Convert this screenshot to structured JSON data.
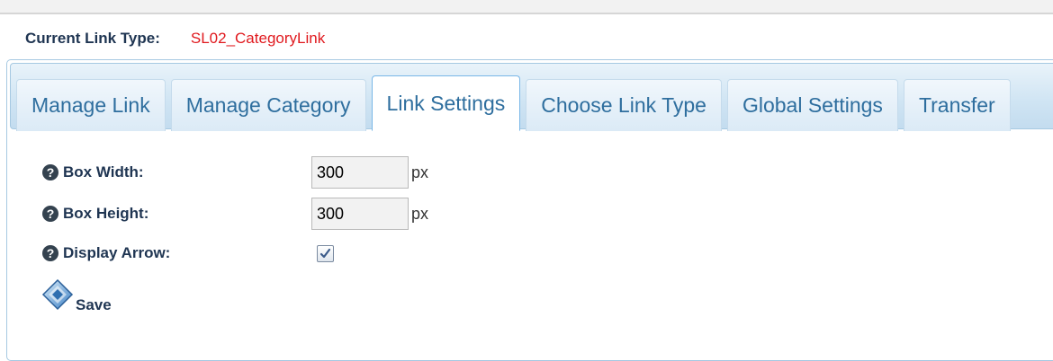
{
  "header": {
    "current_link_type_label": "Current Link Type:",
    "current_link_type_value": "SL02_CategoryLink"
  },
  "tabs": [
    {
      "label": "Manage Link",
      "active": false
    },
    {
      "label": "Manage Category",
      "active": false
    },
    {
      "label": "Link Settings",
      "active": true
    },
    {
      "label": "Choose Link Type",
      "active": false
    },
    {
      "label": "Global Settings",
      "active": false
    },
    {
      "label": "Transfer",
      "active": false
    }
  ],
  "settings": {
    "box_width": {
      "label": "Box Width:",
      "value": "300",
      "unit": "px"
    },
    "box_height": {
      "label": "Box Height:",
      "value": "300",
      "unit": "px"
    },
    "display_arrow": {
      "label": "Display Arrow:",
      "checked": true
    }
  },
  "actions": {
    "save_label": "Save"
  },
  "icons": {
    "help": "help-icon",
    "save": "save-icon",
    "check": "checkmark-icon"
  },
  "colors": {
    "accent_red": "#e0191e",
    "label_navy": "#1f3552",
    "tab_text": "#2e6e9e",
    "tab_border": "#a6c9e2"
  }
}
